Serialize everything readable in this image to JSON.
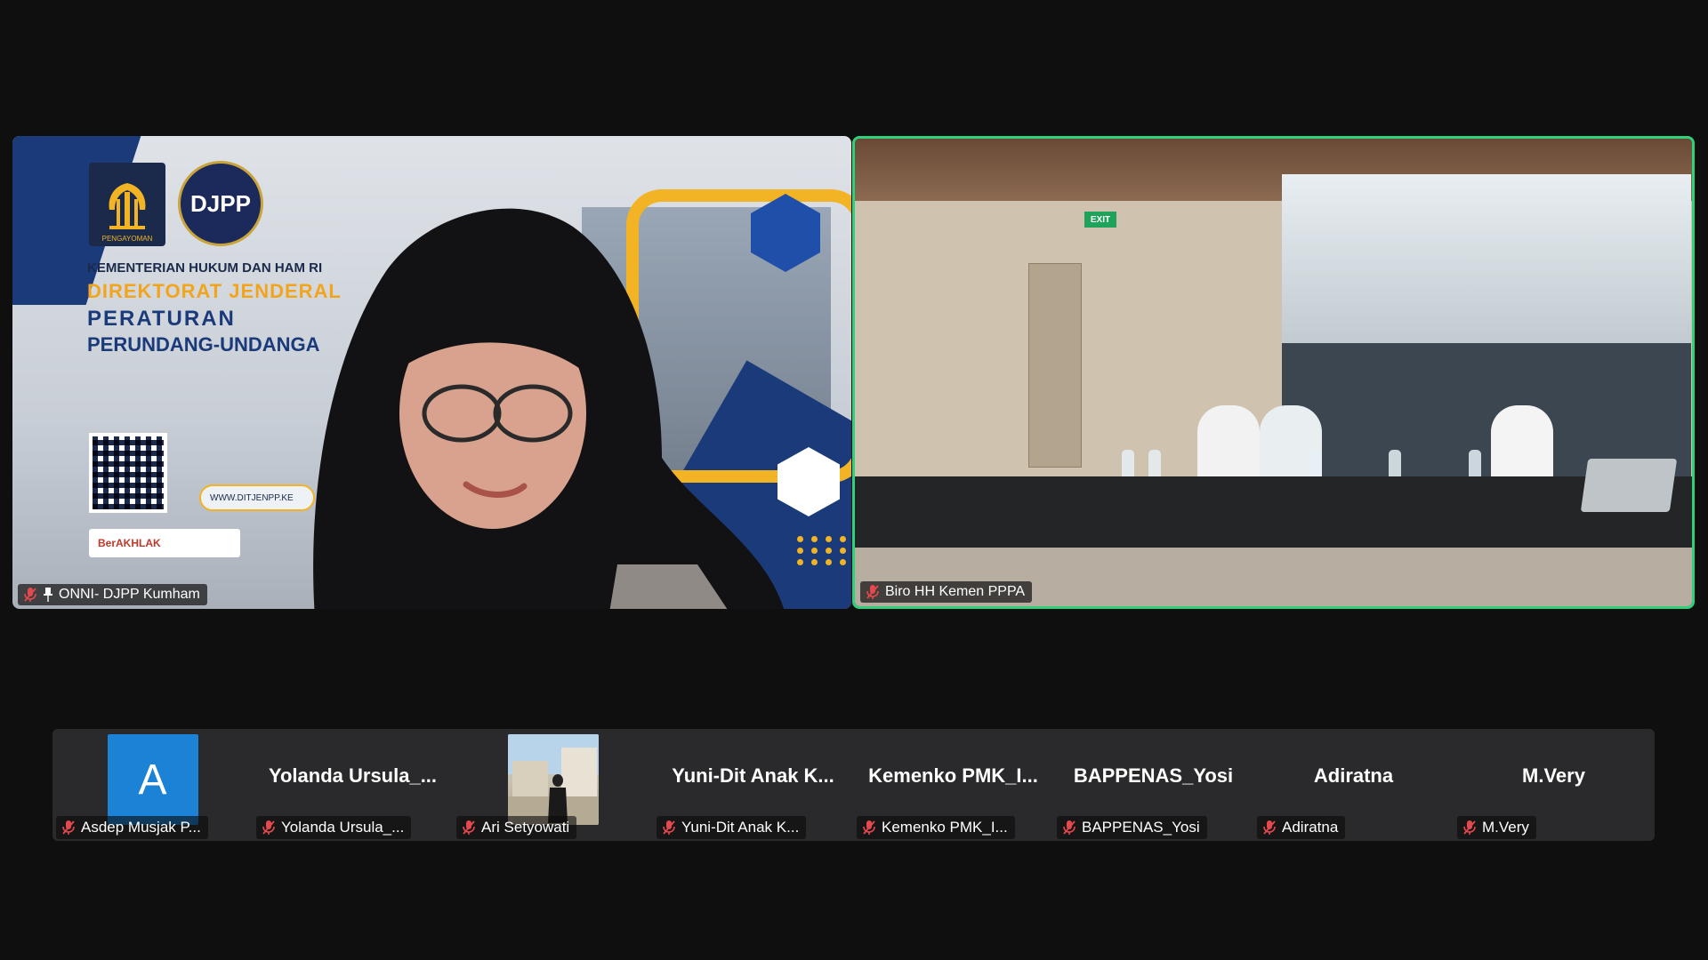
{
  "meeting": {
    "speaker_tiles": [
      {
        "name": "ONNI- DJPP Kumham",
        "muted": true,
        "pinned": true,
        "slide": {
          "ministry": "KEMENTERIAN HUKUM DAN HAM RI",
          "line1": "DIREKTORAT JENDERAL",
          "line2": "PERATURAN",
          "line3": "PERUNDANG-UNDANGA",
          "logo_left_text": "PENGAYOMAN",
          "logo_right_text": "DJPP",
          "website": "WWW.DITJENPP.KE",
          "badge": "BerAKHLAK"
        }
      },
      {
        "name": "Biro HH Kemen PPPA",
        "muted": true,
        "active_speaker": true,
        "exit_sign": "EXIT"
      }
    ],
    "participants": [
      {
        "display": "avatar",
        "avatar_letter": "A",
        "label": "Asdep Musjak P..."
      },
      {
        "display": "name",
        "name": "Yolanda  Ursula_...",
        "label": "Yolanda Ursula_..."
      },
      {
        "display": "photo",
        "label": "Ari Setyowati"
      },
      {
        "display": "name",
        "name": "Yuni-Dit Anak K...",
        "label": "Yuni-Dit Anak K..."
      },
      {
        "display": "name",
        "name": "Kemenko  PMK_I...",
        "label": "Kemenko PMK_I..."
      },
      {
        "display": "name",
        "name": "BAPPENAS_Yosi",
        "label": "BAPPENAS_Yosi"
      },
      {
        "display": "name",
        "name": "Adiratna",
        "label": "Adiratna"
      },
      {
        "display": "name",
        "name": "M.Very",
        "label": "M.Very"
      }
    ],
    "colors": {
      "background": "#0f0f10",
      "active_speaker_border": "#2fd27a",
      "muted_icon": "#e5484d",
      "strip": "#2a2a2c"
    }
  }
}
